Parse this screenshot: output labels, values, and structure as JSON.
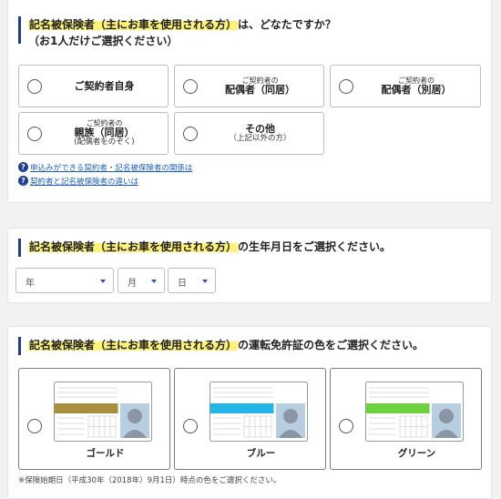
{
  "q1": {
    "highlight": "記名被保険者（主にお車を使用される方）",
    "rest": "は、どなたですか？",
    "line2": "（お1人だけご選択ください）",
    "options": [
      {
        "small": "",
        "main": "ご契約者自身",
        "sub": ""
      },
      {
        "small": "ご契約者の",
        "main": "配偶者（同居）",
        "sub": ""
      },
      {
        "small": "ご契約者の",
        "main": "配偶者（別居）",
        "sub": ""
      },
      {
        "small": "ご契約者の",
        "main": "親族（同居）",
        "sub": "(配偶者をのぞく)"
      },
      {
        "small": "",
        "main": "その他",
        "sub": "（上記以外の方）"
      }
    ],
    "links": [
      {
        "icon": "?",
        "text": "申込みができる契約者・記名被保険者の関係は"
      },
      {
        "icon": "?",
        "text": "契約者と記名被保険者の違いは"
      }
    ]
  },
  "q2": {
    "highlight": "記名被保険者（主にお車を使用される方）",
    "rest": "の生年月日をご選択ください。",
    "selects": {
      "year": "年",
      "month": "月",
      "day": "日"
    }
  },
  "q3": {
    "highlight": "記名被保険者（主にお車を使用される方）",
    "rest": "の運転免許証の色をご選択ください。",
    "cards": [
      {
        "label": "ゴールド",
        "color": "#a88f3f"
      },
      {
        "label": "ブルー",
        "color": "#22b6e8"
      },
      {
        "label": "グリーン",
        "color": "#6cd13e"
      }
    ],
    "note": "※保険始期日（平成30年（2018年）9月1日）時点の色をご選択ください。"
  },
  "colors": {
    "accent_bar": "#1f3c8f",
    "highlight": "#fdf176",
    "link": "#1d5fbf"
  }
}
